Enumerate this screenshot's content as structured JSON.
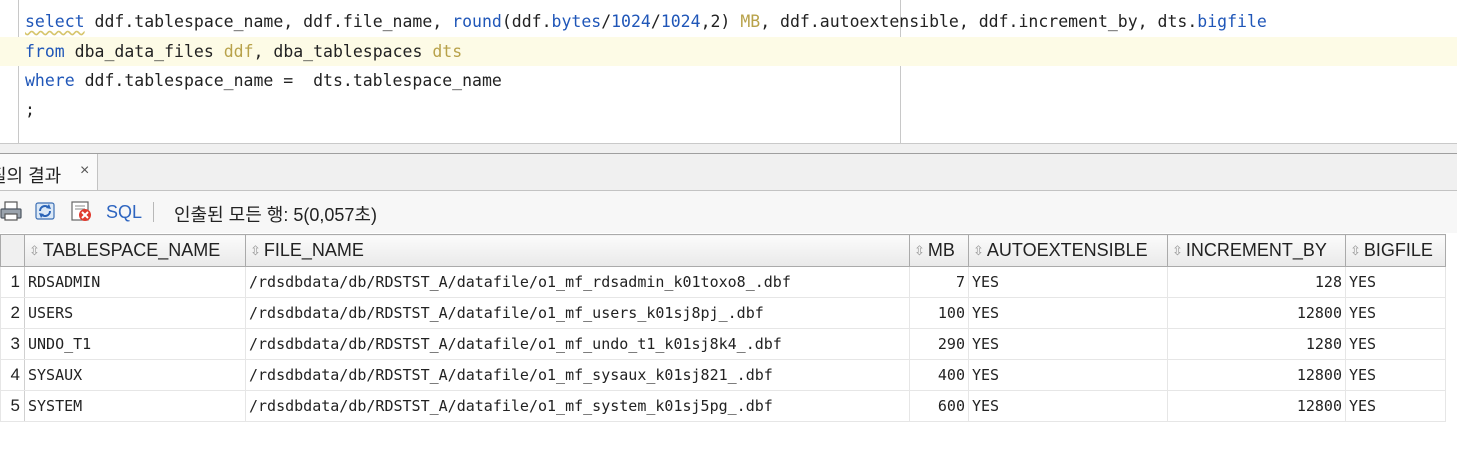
{
  "editor": {
    "lines": [
      [
        "select",
        " ddf.tablespace_name, ddf.file_name, ",
        "round",
        "(ddf.",
        "bytes",
        "/",
        "1024",
        "/",
        "1024",
        ",2) ",
        "MB",
        ", ddf.autoextensible, ddf.increment_by, dts.",
        "bigfile"
      ],
      [
        "from",
        " dba_data_files ",
        "ddf",
        ", dba_tablespaces ",
        "dts"
      ],
      [
        "where",
        " ddf.tablespace_name =  dts.tablespace_name"
      ],
      [
        ";"
      ]
    ]
  },
  "results_tab": {
    "label": "질의 결과",
    "close": "×"
  },
  "toolbar": {
    "sql_label": "SQL",
    "status": "인출된 모든 행: 5(0,057초)",
    "icons": [
      "print-icon",
      "refresh-icon",
      "clear-icon"
    ]
  },
  "grid": {
    "columns": [
      "TABLESPACE_NAME",
      "FILE_NAME",
      "MB",
      "AUTOEXTENSIBLE",
      "INCREMENT_BY",
      "BIGFILE"
    ],
    "rows": [
      {
        "n": "1",
        "tablespace": "RDSADMIN",
        "file": "/rdsdbdata/db/RDSTST_A/datafile/o1_mf_rdsadmin_k01toxo8_.dbf",
        "mb": "7",
        "auto": "YES",
        "inc": "128",
        "big": "YES"
      },
      {
        "n": "2",
        "tablespace": "USERS",
        "file": "/rdsdbdata/db/RDSTST_A/datafile/o1_mf_users_k01sj8pj_.dbf",
        "mb": "100",
        "auto": "YES",
        "inc": "12800",
        "big": "YES"
      },
      {
        "n": "3",
        "tablespace": "UNDO_T1",
        "file": "/rdsdbdata/db/RDSTST_A/datafile/o1_mf_undo_t1_k01sj8k4_.dbf",
        "mb": "290",
        "auto": "YES",
        "inc": "1280",
        "big": "YES"
      },
      {
        "n": "4",
        "tablespace": "SYSAUX",
        "file": "/rdsdbdata/db/RDSTST_A/datafile/o1_mf_sysaux_k01sj821_.dbf",
        "mb": "400",
        "auto": "YES",
        "inc": "12800",
        "big": "YES"
      },
      {
        "n": "5",
        "tablespace": "SYSTEM",
        "file": "/rdsdbdata/db/RDSTST_A/datafile/o1_mf_system_k01sj5pg_.dbf",
        "mb": "600",
        "auto": "YES",
        "inc": "12800",
        "big": "YES"
      }
    ]
  },
  "colors": {
    "keyword": "#1f56b8",
    "alias": "#b8a24a",
    "current_line": "#fdfbe6"
  }
}
